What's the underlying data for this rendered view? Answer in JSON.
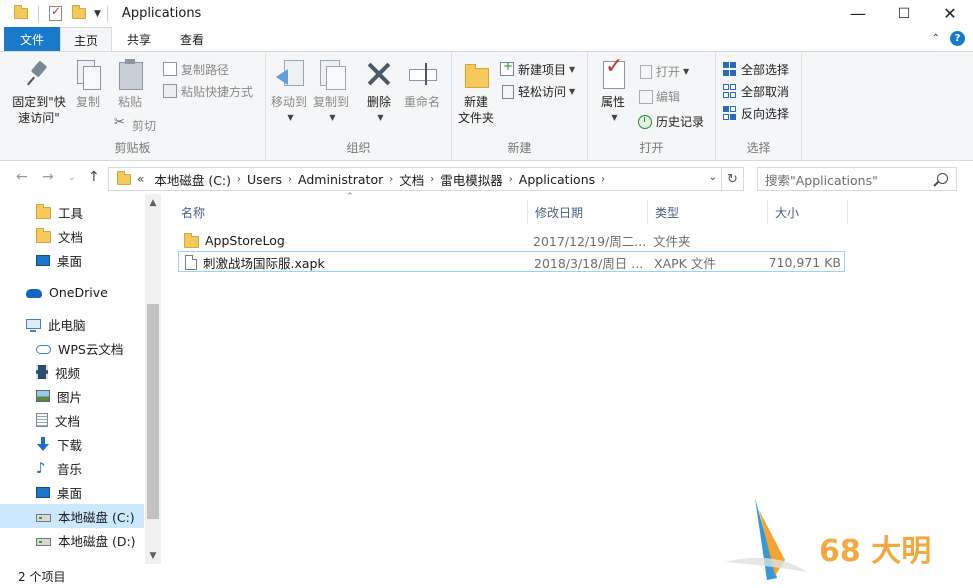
{
  "window": {
    "title": "Applications",
    "controls": {
      "minimize": "—",
      "maximize": "☐",
      "close": "✕"
    }
  },
  "ribbon_tabs": {
    "file": "文件",
    "home": "主页",
    "share": "共享",
    "view": "查看"
  },
  "ribbon": {
    "clipboard": {
      "label": "剪贴板",
      "pin_quick_access": "固定到\"快速访问\"",
      "copy": "复制",
      "paste": "粘贴",
      "copy_path": "复制路径",
      "paste_shortcut": "粘贴快捷方式",
      "cut": "剪切"
    },
    "organize": {
      "label": "组织",
      "move_to": "移动到",
      "copy_to": "复制到",
      "delete": "删除",
      "rename": "重命名"
    },
    "new": {
      "label": "新建",
      "new_folder": "新建\n文件夹",
      "new_item": "新建项目",
      "easy_access": "轻松访问"
    },
    "open": {
      "label": "打开",
      "properties": "属性",
      "open": "打开",
      "edit": "编辑",
      "history": "历史记录"
    },
    "select": {
      "label": "选择",
      "select_all": "全部选择",
      "select_none": "全部取消",
      "invert_selection": "反向选择"
    }
  },
  "address": {
    "overflow": "«",
    "crumbs": [
      "本地磁盘 (C:)",
      "Users",
      "Administrator",
      "文档",
      "雷电模拟器",
      "Applications"
    ],
    "search_placeholder": "搜索\"Applications\""
  },
  "nav_pane": {
    "items": [
      {
        "label": "工具",
        "icon": "folder-icon"
      },
      {
        "label": "文档",
        "icon": "folder-icon"
      },
      {
        "label": "桌面",
        "icon": "desktop-icon"
      },
      {
        "label": "OneDrive",
        "icon": "onedrive-icon"
      },
      {
        "label": "此电脑",
        "icon": "this-pc-icon"
      },
      {
        "label": "WPS云文档",
        "icon": "wps-cloud-icon"
      },
      {
        "label": "视频",
        "icon": "video-icon"
      },
      {
        "label": "图片",
        "icon": "picture-icon"
      },
      {
        "label": "文档",
        "icon": "document-icon"
      },
      {
        "label": "下载",
        "icon": "download-icon"
      },
      {
        "label": "音乐",
        "icon": "music-icon"
      },
      {
        "label": "桌面",
        "icon": "desktop-icon"
      },
      {
        "label": "本地磁盘 (C:)",
        "icon": "drive-icon",
        "selected": true
      },
      {
        "label": "本地磁盘 (D:)",
        "icon": "drive-icon"
      }
    ]
  },
  "file_list": {
    "columns": {
      "name": "名称",
      "modified": "修改日期",
      "type": "类型",
      "size": "大小"
    },
    "rows": [
      {
        "name": "AppStoreLog",
        "modified": "2017/12/19/周二...",
        "type": "文件夹",
        "size": "",
        "icon": "folder-icon"
      },
      {
        "name": "刺激战场国际服.xapk",
        "modified": "2018/3/18/周日 ...",
        "type": "XAPK 文件",
        "size": "710,971 KB",
        "icon": "file-icon"
      }
    ]
  },
  "status": {
    "item_count": "2 个项目"
  },
  "watermark": {
    "text": "68 大明"
  },
  "colors": {
    "accent": "#1979ca",
    "selection": "#cce8ff",
    "folder": "#f5c95c"
  }
}
